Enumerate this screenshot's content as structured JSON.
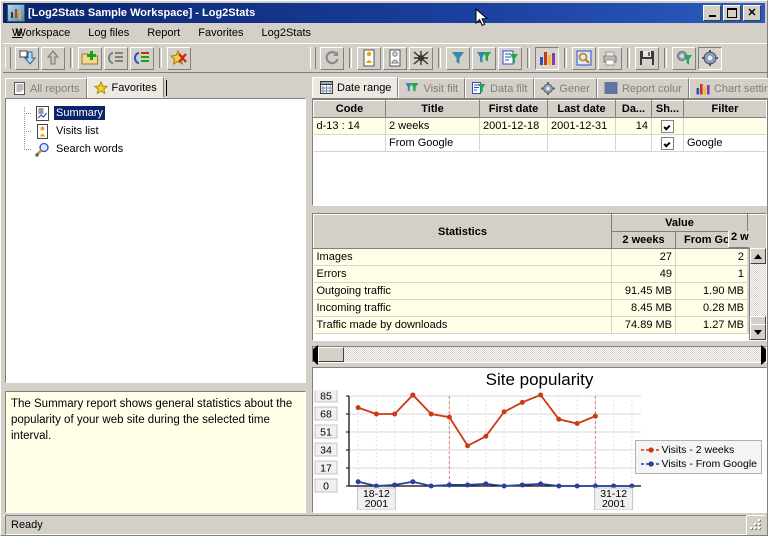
{
  "window": {
    "title": "[Log2Stats Sample Workspace] - Log2Stats",
    "minimize_label": "",
    "maximize_label": "",
    "close_label": "✕"
  },
  "menu": {
    "items": [
      {
        "label": "Workspace"
      },
      {
        "label": "Log files"
      },
      {
        "label": "Report"
      },
      {
        "label": "Favorites"
      },
      {
        "label": "Log2Stats"
      }
    ]
  },
  "toolbar_left": {
    "buttons": [
      {
        "name": "import-log-button",
        "icon": "download-arrow-icon",
        "state": "raised"
      },
      {
        "name": "export-button",
        "icon": "upload-arrow-icon",
        "state": "raised"
      },
      {
        "name": "new-report-button",
        "icon": "folder-add-icon",
        "state": "raised"
      },
      {
        "name": "edit-report-button",
        "icon": "list-edit-icon",
        "state": "raised"
      },
      {
        "name": "report-properties-button",
        "icon": "list-green-icon",
        "state": "raised"
      },
      {
        "name": "delete-favorite-button",
        "icon": "star-delete-icon",
        "state": "raised"
      }
    ]
  },
  "toolbar_right": {
    "buttons": [
      {
        "name": "refresh-button",
        "icon": "refresh-icon",
        "state": "raised"
      },
      {
        "name": "visitor-button",
        "icon": "person-orange-icon",
        "state": "raised"
      },
      {
        "name": "visitor-filter-button",
        "icon": "person-white-icon",
        "state": "raised"
      },
      {
        "name": "robot-button",
        "icon": "spider-icon",
        "state": "raised"
      },
      {
        "name": "filter-button",
        "icon": "funnel-blue-icon",
        "state": "raised"
      },
      {
        "name": "visit-filter-button",
        "icon": "funnel-green-icon",
        "state": "raised"
      },
      {
        "name": "data-filter-button",
        "icon": "data-filter-icon",
        "state": "raised"
      },
      {
        "name": "chart-button",
        "icon": "bar-chart-icon",
        "state": "pressed"
      },
      {
        "name": "preview-button",
        "icon": "preview-icon",
        "state": "raised"
      },
      {
        "name": "print-button",
        "icon": "printer-icon",
        "state": "raised"
      },
      {
        "name": "save-button",
        "icon": "floppy-disk-icon",
        "state": "raised"
      },
      {
        "name": "report-colors-button",
        "icon": "gear-green-icon",
        "state": "raised"
      },
      {
        "name": "general-settings-button",
        "icon": "gear-blue-icon",
        "state": "pressed"
      }
    ]
  },
  "left_tabs": [
    {
      "label": "All reports",
      "icon": "document-icon",
      "active": false
    },
    {
      "label": "Favorites",
      "icon": "star-icon",
      "active": true
    }
  ],
  "right_tabs": [
    {
      "label": "Date range",
      "icon": "calendar-icon",
      "active": true
    },
    {
      "label": "Visit filt",
      "icon": "funnel-green-icon",
      "active": false
    },
    {
      "label": "Data filt",
      "icon": "data-filter-icon",
      "active": false
    },
    {
      "label": "Gener",
      "icon": "gear-icon",
      "active": false
    },
    {
      "label": "Report colur",
      "icon": "list-lines-icon",
      "active": false
    },
    {
      "label": "Chart settir",
      "icon": "bar-chart-icon",
      "active": false
    }
  ],
  "tree": {
    "items": [
      {
        "label": "Summary",
        "icon": "summary-report-icon",
        "selected": true
      },
      {
        "label": "Visits list",
        "icon": "visits-list-icon",
        "selected": false
      },
      {
        "label": "Search words",
        "icon": "magnifier-icon",
        "selected": false
      }
    ]
  },
  "description": "The Summary report shows general statistics about the popularity of your web site during the selected time interval.",
  "status": {
    "text": "Ready"
  },
  "date_range_grid": {
    "columns": [
      "Code",
      "Title",
      "First date",
      "Last date",
      "Da...",
      "Sh...",
      "Filter"
    ],
    "rows": [
      {
        "code": "d-13 : 14",
        "title": "2 weeks",
        "first_date": "2001-12-18",
        "last_date": "2001-12-31",
        "days": "14",
        "show": true,
        "filter": ""
      },
      {
        "code": "",
        "title": "From Google",
        "first_date": "",
        "last_date": "",
        "days": "",
        "show": true,
        "filter": "Google"
      }
    ]
  },
  "stats_grid": {
    "header_main": "Statistics",
    "header_value": "Value",
    "value_columns": [
      "2 weeks",
      "From Go...",
      "2 w"
    ],
    "rows": [
      {
        "name": "Images",
        "v1": "27",
        "v2": "2",
        "v3": ""
      },
      {
        "name": "Errors",
        "v1": "49",
        "v2": "1",
        "v3": ""
      },
      {
        "name": "Outgoing traffic",
        "v1": "91.45 MB",
        "v2": "1.90 MB",
        "v3": ""
      },
      {
        "name": "Incoming traffic",
        "v1": "8.45 MB",
        "v2": "0.28 MB",
        "v3": ""
      },
      {
        "name": "Traffic made by downloads",
        "v1": "74.89 MB",
        "v2": "1.27 MB",
        "v3": ""
      }
    ]
  },
  "chart_data": {
    "type": "line",
    "title": "Site popularity",
    "xlabel": "",
    "ylabel": "",
    "ylim": [
      0,
      85
    ],
    "yticks": [
      0,
      17,
      34,
      51,
      68,
      85
    ],
    "grid": true,
    "legend_position": "right",
    "x_axis_labels": [
      {
        "text_line1": "18-12",
        "text_line2": "2001",
        "index": 1
      },
      {
        "text_line1": "31-12",
        "text_line2": "2001",
        "index": 14
      }
    ],
    "x": [
      0,
      1,
      2,
      3,
      4,
      5,
      6,
      7,
      8,
      9,
      10,
      11,
      12,
      13,
      14,
      15
    ],
    "series": [
      {
        "name": "Visits - 2 weeks",
        "color": "#cc3a14",
        "values": [
          74,
          68,
          68,
          86,
          68,
          65,
          38,
          47,
          70,
          79,
          86,
          63,
          59,
          66
        ]
      },
      {
        "name": "Visits - From Google",
        "color": "#27409c",
        "values": [
          4,
          0,
          1,
          4,
          0,
          1,
          1,
          2,
          0,
          1,
          2,
          0,
          0,
          0,
          0,
          0
        ]
      }
    ],
    "marker_lines": [
      {
        "x_index": 5,
        "color": "#e08080"
      },
      {
        "x_index": 13,
        "color": "#e08080"
      }
    ]
  }
}
